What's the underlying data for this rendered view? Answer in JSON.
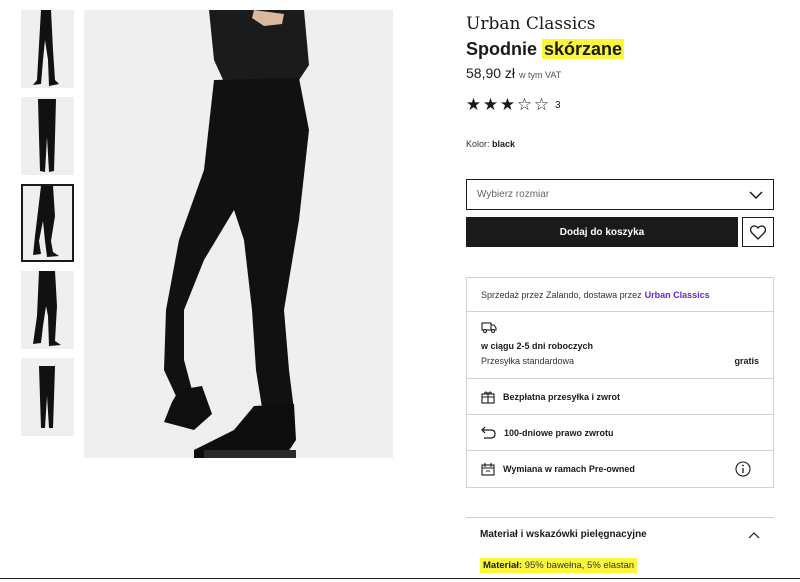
{
  "product": {
    "brand": "Urban Classics",
    "title_prefix": "Spodnie",
    "title_highlight": "skórzane",
    "price": "58,90 zł",
    "vat_note": "w tym VAT",
    "rating": {
      "value": 3,
      "max": 5,
      "count": "3"
    },
    "color_label": "Kolor:",
    "color_value": "black"
  },
  "size_select": {
    "placeholder": "Wybierz rozmiar",
    "icon": "chevron-down-icon"
  },
  "actions": {
    "add_to_cart": "Dodaj do koszyka",
    "wishlist_icon": "heart-icon"
  },
  "info": {
    "seller_text": "Sprzedaż przez Zalando, dostawa przez",
    "seller_link": "Urban Classics",
    "delivery_time": "w ciągu 2-5 dni roboczych",
    "delivery_type": "Przesyłka standardowa",
    "delivery_price": "gratis",
    "free_shipping": "Bezpłatna przesyłka i zwrot",
    "returns": "100-dniowe prawo zwrotu",
    "preowned": "Wymiana w ramach Pre-owned"
  },
  "material": {
    "heading": "Materiał i wskazówki pielęgnacyjne",
    "label": "Materiał:",
    "value": "95% bawełna, 5% elastan"
  },
  "gallery": {
    "thumb_count": 5,
    "active_index": 2
  },
  "colors": {
    "accent_link": "#6328e0",
    "highlight": "#fbf73a",
    "button": "#1a1a1a"
  }
}
